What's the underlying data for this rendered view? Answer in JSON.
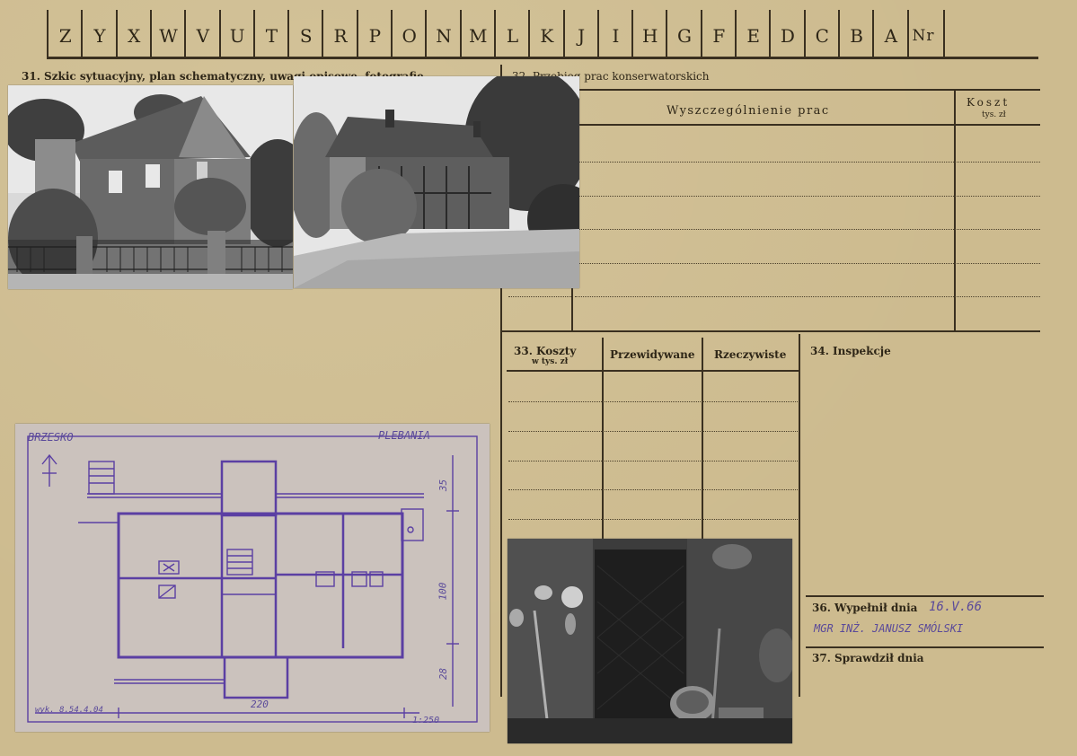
{
  "header": {
    "letters": [
      "Z",
      "Y",
      "X",
      "W",
      "V",
      "U",
      "T",
      "S",
      "R",
      "P",
      "O",
      "N",
      "M",
      "L",
      "K",
      "J",
      "I",
      "H",
      "G",
      "F",
      "E",
      "D",
      "C",
      "B",
      "A",
      "Nr"
    ]
  },
  "section31": {
    "label": "31. Szkic sytuacyjny, plan schematyczny, uwagi opisowe, fotografie"
  },
  "section32": {
    "label": "32. Przebieg prac konserwatorskich",
    "col_works": "Wyszczególnienie prac",
    "col_cost": "Koszt",
    "col_cost_unit": "tys. zł"
  },
  "section33": {
    "label": "33. Koszty",
    "label_unit": "w tys. zł",
    "col_planned": "Przewidywane",
    "col_actual": "Rzeczywiste"
  },
  "section34": {
    "label": "34. Inspekcje"
  },
  "section36": {
    "label": "36. Wypełnił dnia",
    "date": "16.V.66",
    "name": "MGR INŻ. JANUSZ SMÓLSKI"
  },
  "section37": {
    "label": "37. Sprawdził dnia"
  },
  "plan": {
    "town": "BRZESKO",
    "building": "PLEBANIA",
    "dim_top": "35",
    "dim_mid": "100",
    "dim_bottom": "28",
    "dim_width": "220",
    "scale": "1:250",
    "drafter": "wyk. 8.54.4.04"
  },
  "colors": {
    "card": "#cdbb8f",
    "ink": "#3a3020",
    "plan_ink": "#5b3fa3",
    "plan_paper": "#c9bfb8"
  }
}
